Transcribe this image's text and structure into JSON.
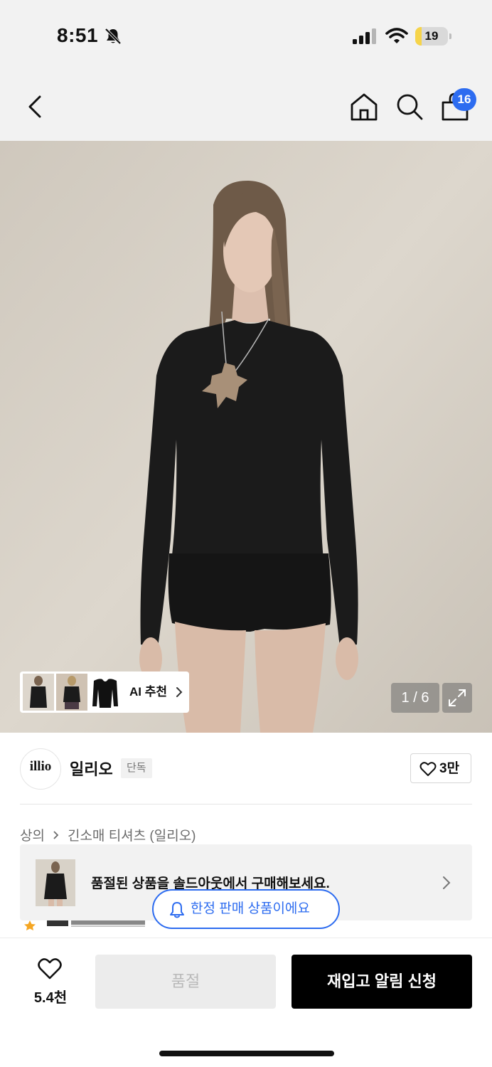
{
  "status_bar": {
    "time": "8:51",
    "battery_level": "19",
    "battery_fraction": 0.19,
    "battery_color": "#f6d44a",
    "icons": [
      "bell-slash-icon",
      "cellular-signal-icon",
      "wifi-icon",
      "battery-icon"
    ]
  },
  "nav": {
    "icons": [
      "back-arrow-icon",
      "home-icon",
      "search-icon",
      "shopping-bag-icon"
    ],
    "cart_count": "16",
    "badge_color": "#2d6cf0"
  },
  "hero": {
    "ai_recommend_label": "AI 추천",
    "image_counter": "1 / 6",
    "icons": [
      "chevron-right-icon",
      "expand-icon"
    ]
  },
  "brand": {
    "logo_text": "illio",
    "name": "일리오",
    "badge": "단독",
    "likes": "3만"
  },
  "breadcrumb": {
    "items": [
      "상의",
      "긴소매 티셔츠 (일리오)"
    ]
  },
  "soldout_banner": {
    "text": "품절된 상품을 솔드아웃에서 구매해보세요."
  },
  "limited_pill": {
    "text": "한정 판매 상품이에요"
  },
  "bottom_bar": {
    "wish_count": "5.4천",
    "soldout_label": "품절",
    "restock_label": "재입고 알림 신청"
  }
}
